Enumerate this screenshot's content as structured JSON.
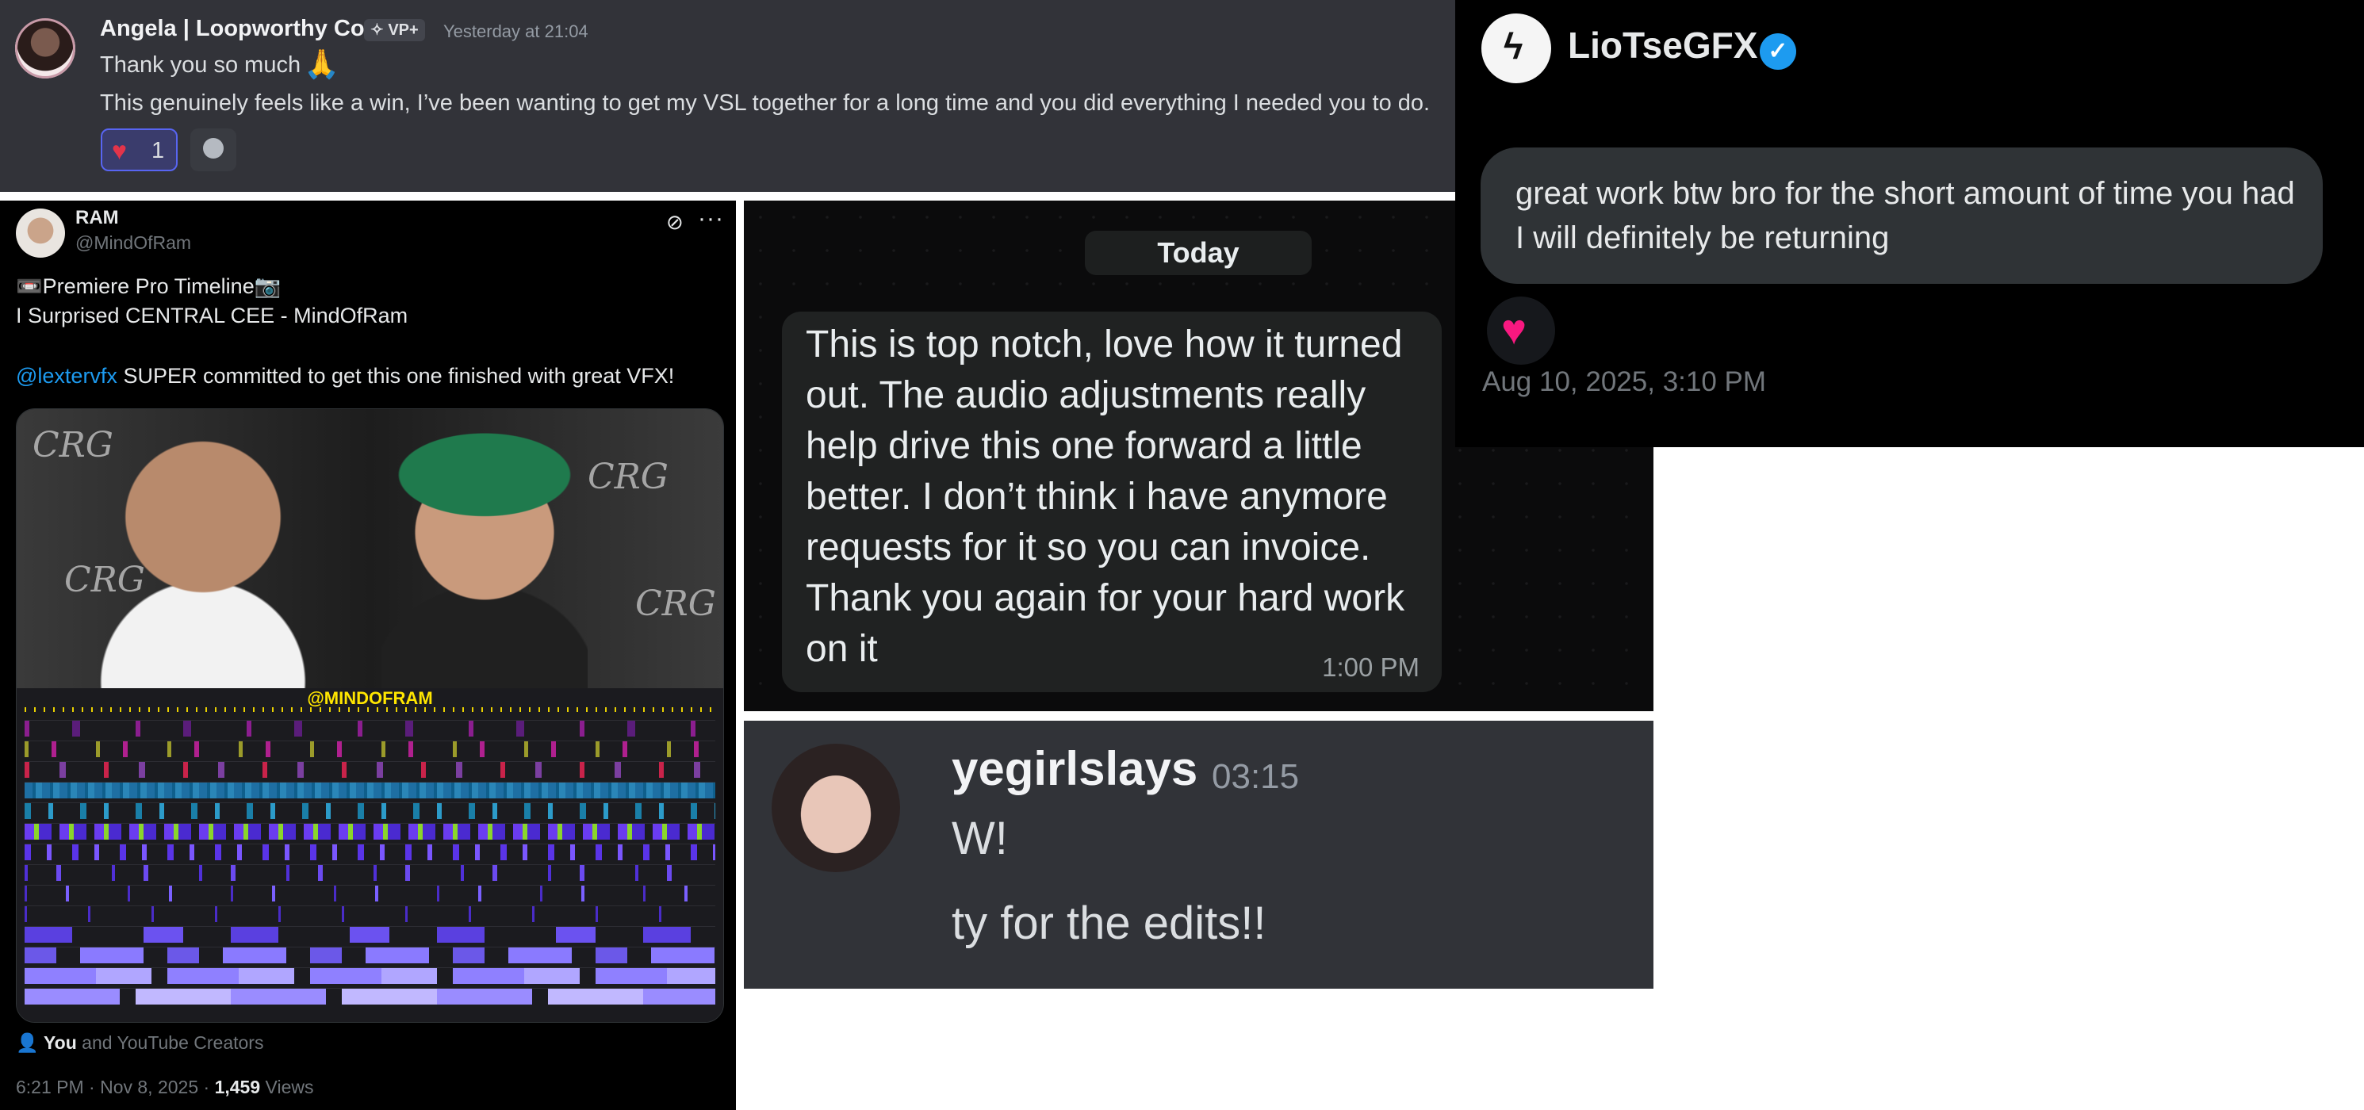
{
  "discord_top": {
    "user": "Angela | Loopworthy Co.",
    "badge": "✧ VP+",
    "time": "Yesterday at 21:04",
    "line1": "Thank you so much",
    "line1_emoji": "🙏",
    "line2": "This genuinely feels like a win, I’ve been wanting to get my VSL together for a long time and you did everything I needed you to do.",
    "reaction_emoji": "♥",
    "reaction_count": "1"
  },
  "x_post": {
    "name": "RAM",
    "handle": "@MindOfRam",
    "line1": "📼Premiere Pro Timeline📷",
    "line2": "I Surprised CENTRAL CEE - MindOfRam",
    "mention": "@lextervfx",
    "line3_rest": " SUPER committed to get this one finished with great VFX!",
    "timeline_tag": "@MINDOFRAM",
    "liked_you": "You",
    "liked_rest": " and YouTube Creators",
    "meta": "6:21 PM · Nov 8, 2025 · ",
    "views_count": "1,459",
    "views_label": " Views",
    "wall_text": "CRG"
  },
  "whatsapp": {
    "day_label": "Today",
    "message": "This is top notch, love how it turned out. The audio adjustments really help drive this one forward a little better. I don’t think i have anymore requests for it so you can invoice. Thank you again for your hard work on it",
    "time": "1:00 PM"
  },
  "discord_bottom": {
    "user": "yegirlslays",
    "time": "03:15",
    "line1": "W!",
    "line2": "ty for the edits!!"
  },
  "x_dm": {
    "name": "LioTseGFX",
    "avatar_glyph": "ϟ",
    "message": "great work btw bro for the short amount of time you had I will definitely be returning",
    "reaction": "♥",
    "timestamp": "Aug 10, 2025, 3:10 PM"
  },
  "colors": {
    "discord_bg": "#323339",
    "x_bg": "#000000",
    "link_blue": "#1d9bf0",
    "heart_red": "#e3344a"
  }
}
